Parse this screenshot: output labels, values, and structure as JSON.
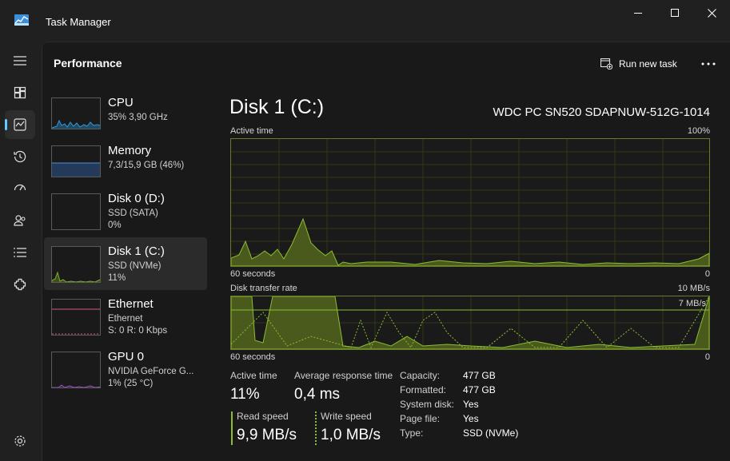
{
  "window": {
    "title": "Task Manager"
  },
  "nav": {
    "items": [
      {
        "name": "hamburger-menu-icon",
        "active": false
      },
      {
        "name": "processes-icon",
        "active": false
      },
      {
        "name": "performance-icon",
        "active": true
      },
      {
        "name": "app-history-icon",
        "active": false
      },
      {
        "name": "startup-apps-icon",
        "active": false
      },
      {
        "name": "users-icon",
        "active": false
      },
      {
        "name": "details-icon",
        "active": false
      },
      {
        "name": "services-icon",
        "active": false
      }
    ],
    "settings": "settings-icon"
  },
  "header": {
    "title": "Performance",
    "run_new_task": "Run new task",
    "more": "..."
  },
  "devices": [
    {
      "name": "CPU",
      "sub": "35%  3,90 GHz",
      "sub2": "",
      "color": "#2f9bd8",
      "active": false
    },
    {
      "name": "Memory",
      "sub": "7,3/15,9 GB (46%)",
      "sub2": "",
      "color": "#4d8fd6",
      "active": false
    },
    {
      "name": "Disk 0 (D:)",
      "sub": "SSD (SATA)",
      "sub2": "0%",
      "color": "#6aa52f",
      "active": false
    },
    {
      "name": "Disk 1 (C:)",
      "sub": "SSD (NVMe)",
      "sub2": "11%",
      "color": "#7bb12e",
      "active": true
    },
    {
      "name": "Ethernet",
      "sub": "Ethernet",
      "sub2": "S: 0  R: 0 Kbps",
      "color": "#d25a82",
      "active": false
    },
    {
      "name": "GPU 0",
      "sub": "NVIDIA GeForce G...",
      "sub2": "1%  (25 °C)",
      "color": "#9a4fc2",
      "active": false
    }
  ],
  "detail": {
    "title": "Disk 1 (C:)",
    "model": "WDC PC SN520 SDAPNUW-512G-1014",
    "active_time_graph": {
      "label": "Active time",
      "max": "100%",
      "time_span": "60 seconds",
      "min": "0"
    },
    "transfer_graph": {
      "label": "Disk transfer rate",
      "max": "10 MB/s",
      "time_span": "60 seconds",
      "min": "0",
      "ref_line_label": "7 MB/s"
    },
    "stats": {
      "active_time_label": "Active time",
      "active_time_value": "11%",
      "avg_response_label": "Average response time",
      "avg_response_value": "0,4 ms",
      "read_speed_label": "Read speed",
      "read_speed_value": "9,9 MB/s",
      "write_speed_label": "Write speed",
      "write_speed_value": "1,0 MB/s"
    },
    "properties": [
      {
        "label": "Capacity:",
        "value": "477 GB"
      },
      {
        "label": "Formatted:",
        "value": "477 GB"
      },
      {
        "label": "System disk:",
        "value": "Yes"
      },
      {
        "label": "Page file:",
        "value": "Yes"
      },
      {
        "label": "Type:",
        "value": "SSD (NVMe)"
      }
    ]
  },
  "colors": {
    "accent": "#60cdff",
    "disk_line": "#8bbd32",
    "disk_fill": "#4a5a1c",
    "graph_border": "#6c7a2e",
    "grid": "#2e3a14"
  }
}
